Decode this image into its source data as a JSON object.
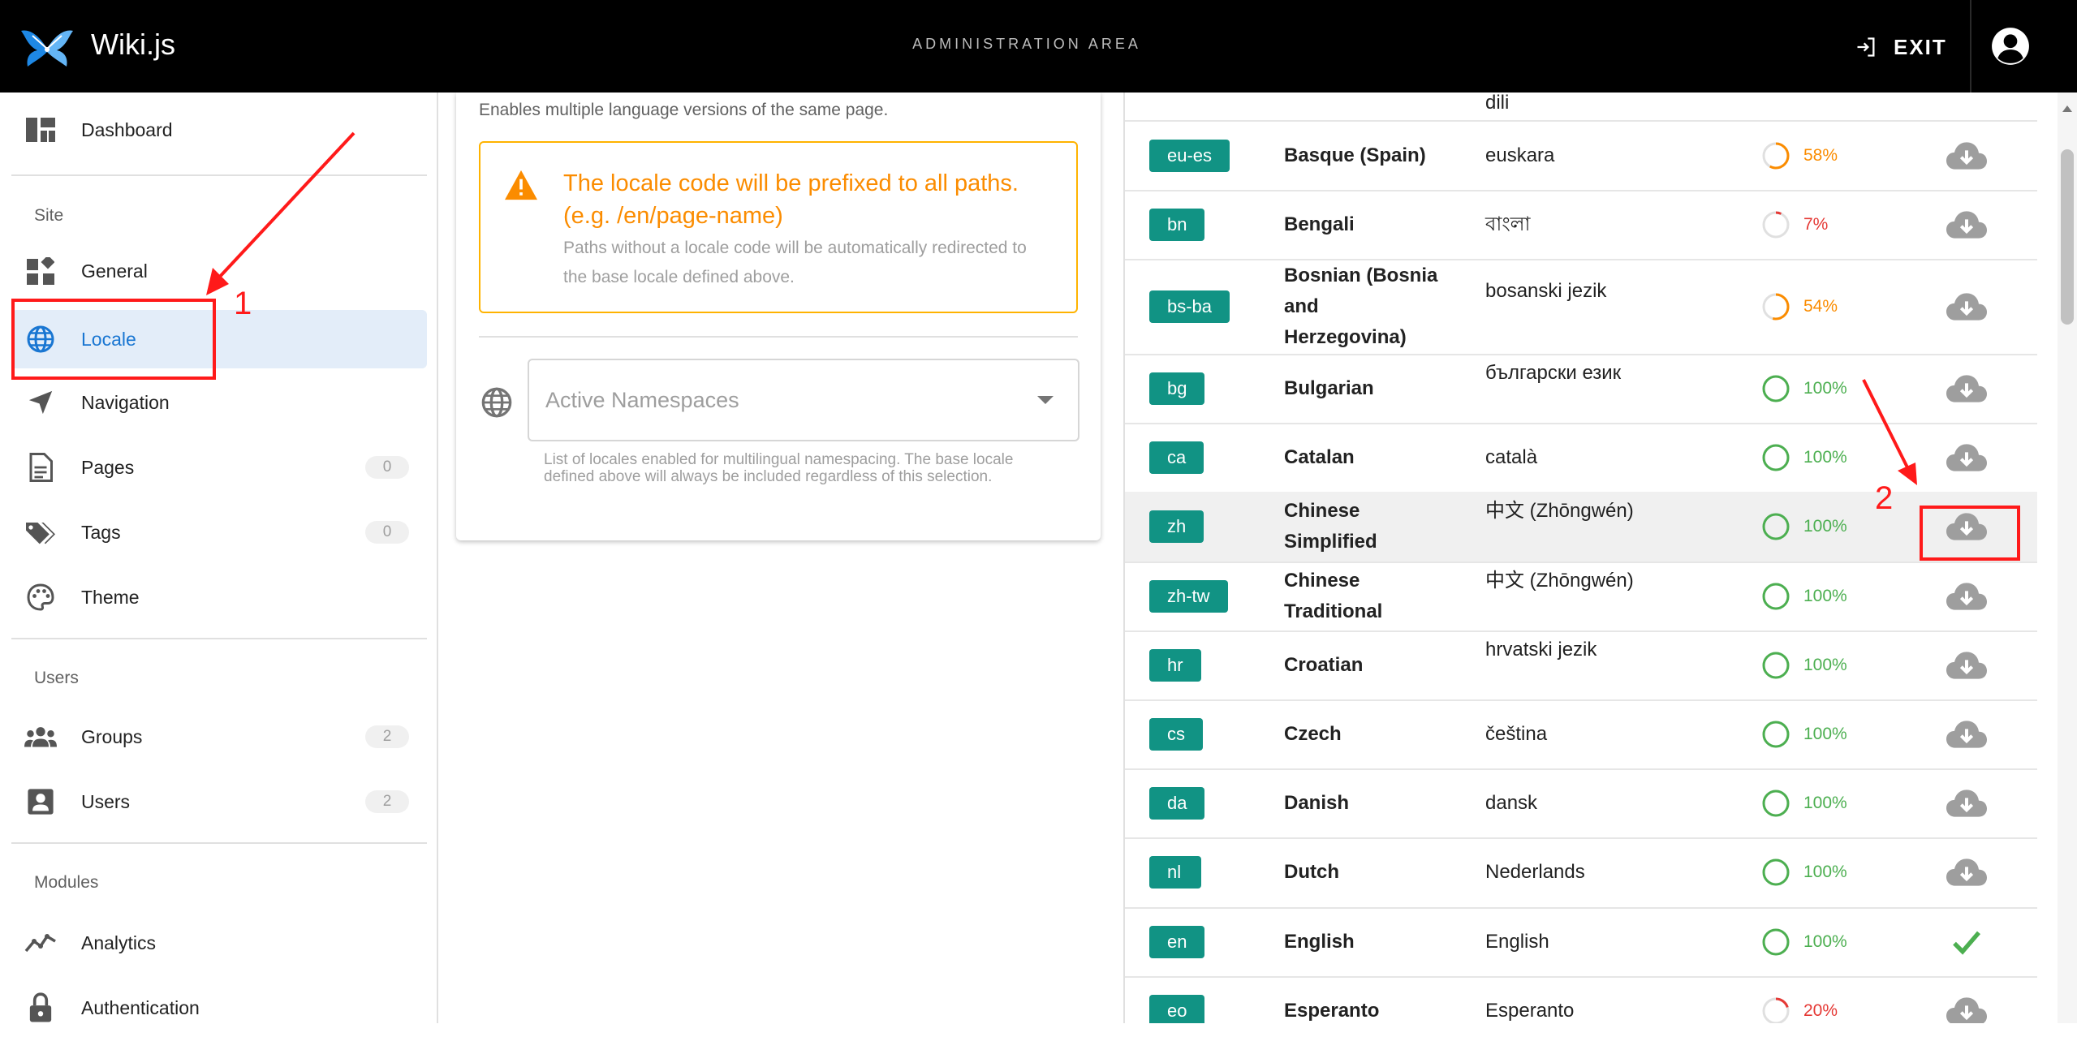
{
  "header": {
    "brand": "Wiki.js",
    "title": "ADMINISTRATION AREA",
    "exit_label": "EXIT"
  },
  "sidebar": {
    "items": [
      {
        "label": "Dashboard",
        "icon": "dashboard-icon"
      },
      {
        "label": "General",
        "icon": "widgets-icon"
      },
      {
        "label": "Locale",
        "icon": "globe-icon",
        "active": true
      },
      {
        "label": "Navigation",
        "icon": "navigation-icon"
      },
      {
        "label": "Pages",
        "icon": "file-icon",
        "count": "0"
      },
      {
        "label": "Tags",
        "icon": "tags-icon",
        "count": "0"
      },
      {
        "label": "Theme",
        "icon": "palette-icon"
      },
      {
        "label": "Groups",
        "icon": "groups-icon",
        "count": "2"
      },
      {
        "label": "Users",
        "icon": "account-box-icon",
        "count": "2"
      },
      {
        "label": "Analytics",
        "icon": "chart-line-icon"
      },
      {
        "label": "Authentication",
        "icon": "lock-icon"
      }
    ],
    "sections": {
      "site": "Site",
      "users": "Users",
      "modules": "Modules"
    }
  },
  "namespacing": {
    "hint": "Enables multiple language versions of the same page.",
    "alert_title": "The locale code will be prefixed to all paths. (e.g. /en/page-name)",
    "alert_body": "Paths without a locale code will be automatically redirected to the base locale defined above.",
    "select_placeholder": "Active Namespaces",
    "select_help": "List of locales enabled for multilingual namespacing. The base locale defined above will always be included regardless of this selection."
  },
  "locales": [
    {
      "code": "",
      "name": "",
      "native": "dili",
      "progress": "",
      "pct": 0.0
    },
    {
      "code": "eu-es",
      "name": "Basque (Spain)",
      "native": "euskara",
      "progress": "58%",
      "pct": 0.58
    },
    {
      "code": "bn",
      "name": "Bengali",
      "native": "বাংলা",
      "progress": "7%",
      "pct": 0.07
    },
    {
      "code": "bs-ba",
      "name": "Bosnian (Bosnia and Herzegovina)",
      "native": "bosanski jezik",
      "progress": "54%",
      "pct": 0.54
    },
    {
      "code": "bg",
      "name": "Bulgarian",
      "native": "български език",
      "progress": "100%",
      "pct": 1.0
    },
    {
      "code": "ca",
      "name": "Catalan",
      "native": "català",
      "progress": "100%",
      "pct": 1.0
    },
    {
      "code": "zh",
      "name": "Chinese Simplified",
      "native": "中文 (Zhōngwén)",
      "progress": "100%",
      "pct": 1.0
    },
    {
      "code": "zh-tw",
      "name": "Chinese Traditional",
      "native": "中文 (Zhōngwén)",
      "progress": "100%",
      "pct": 1.0
    },
    {
      "code": "hr",
      "name": "Croatian",
      "native": "hrvatski jezik",
      "progress": "100%",
      "pct": 1.0
    },
    {
      "code": "cs",
      "name": "Czech",
      "native": "čeština",
      "progress": "100%",
      "pct": 1.0
    },
    {
      "code": "da",
      "name": "Danish",
      "native": "dansk",
      "progress": "100%",
      "pct": 1.0
    },
    {
      "code": "nl",
      "name": "Dutch",
      "native": "Nederlands",
      "progress": "100%",
      "pct": 1.0
    },
    {
      "code": "en",
      "name": "English",
      "native": "English",
      "progress": "100%",
      "pct": 1.0,
      "installed": true
    },
    {
      "code": "eo",
      "name": "Esperanto",
      "native": "Esperanto",
      "progress": "20%",
      "pct": 0.2
    }
  ],
  "annotations": {
    "n1": "1",
    "n2": "2"
  },
  "colors": {
    "accent": "#1976d2",
    "teal_badge": "#119384",
    "complete": "#4caf50",
    "partial": "#fb8c00",
    "low": "#e53935",
    "annotation": "#ff1a1a"
  }
}
